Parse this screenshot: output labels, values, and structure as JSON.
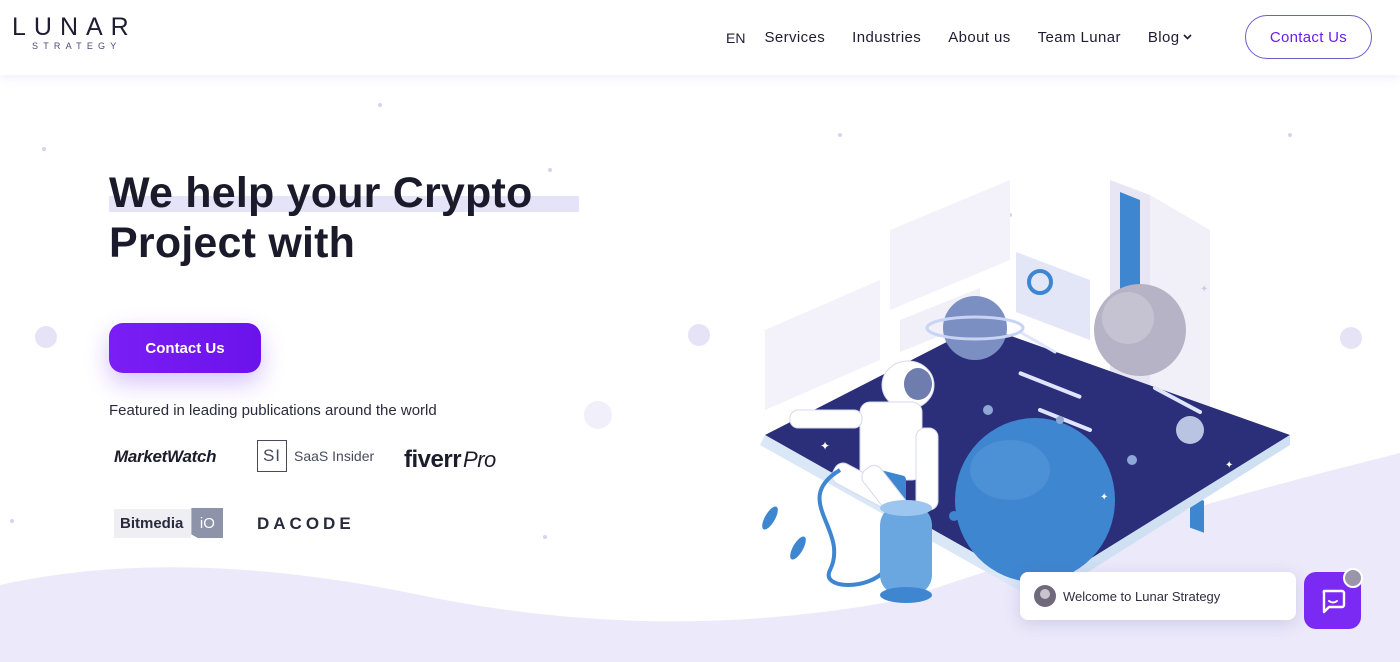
{
  "brand": {
    "name": "LUNAR",
    "tagline": "STRATEGY"
  },
  "nav": {
    "lang": "EN",
    "items": [
      "Services",
      "Industries",
      "About us",
      "Team Lunar"
    ],
    "blog": "Blog",
    "contact": "Contact Us"
  },
  "hero": {
    "title_line1": "We help your Crypto",
    "title_line2": "Project with",
    "cta": "Contact Us",
    "featured_text": "Featured in leading publications around the world"
  },
  "press": {
    "marketwatch_a": "Market",
    "marketwatch_b": "Watch",
    "saas_box": "SI",
    "saas_text": "SaaS Insider",
    "fiverr": "fiverr",
    "fiverr_pro": "Pro",
    "bitmedia": "Bitmedia",
    "bitmedia_io": "iO",
    "dacode": "DACODE"
  },
  "chat": {
    "welcome": "Welcome to Lunar Strategy"
  },
  "colors": {
    "accent": "#7a1ef5",
    "text": "#1b1a2b",
    "hero_wave": "#e9e6fb",
    "platform": "#2b2f7a"
  },
  "icons": {
    "blog_chevron": "chevron-down-icon",
    "chat": "chat-icon"
  }
}
